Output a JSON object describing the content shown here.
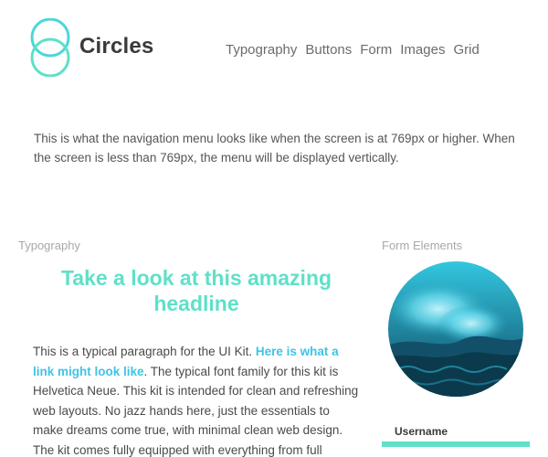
{
  "header": {
    "brand": "Circles",
    "nav": [
      "Typography",
      "Buttons",
      "Form",
      "Images",
      "Grid"
    ]
  },
  "intro": {
    "text": "This is what the navigation menu looks like when the screen is at 769px or higher. When the screen is less than 769px, the menu will be displayed vertically."
  },
  "typography": {
    "section_label": "Typography",
    "headline": "Take a look at this amazing headline",
    "para_start": "This is a typical paragraph for the UI Kit. ",
    "link_text": "Here is what a link might look like",
    "para_rest": ". The typical font family for this kit is Helvetica Neue. This kit is intended for clean and refreshing web layouts. No jazz hands here, just the essentials to make dreams come true, with minimal clean web design. The kit comes fully equipped with everything from full responsive"
  },
  "form": {
    "section_label": "Form Elements",
    "username_label": "Username",
    "username_value": ""
  },
  "colors": {
    "accent": "#5fe0c9",
    "link": "#3fc3e6",
    "logo": "#4dd6d8"
  },
  "icons": {
    "logo": "two-overlapping-circles-icon",
    "image": "ocean-wave-image"
  }
}
